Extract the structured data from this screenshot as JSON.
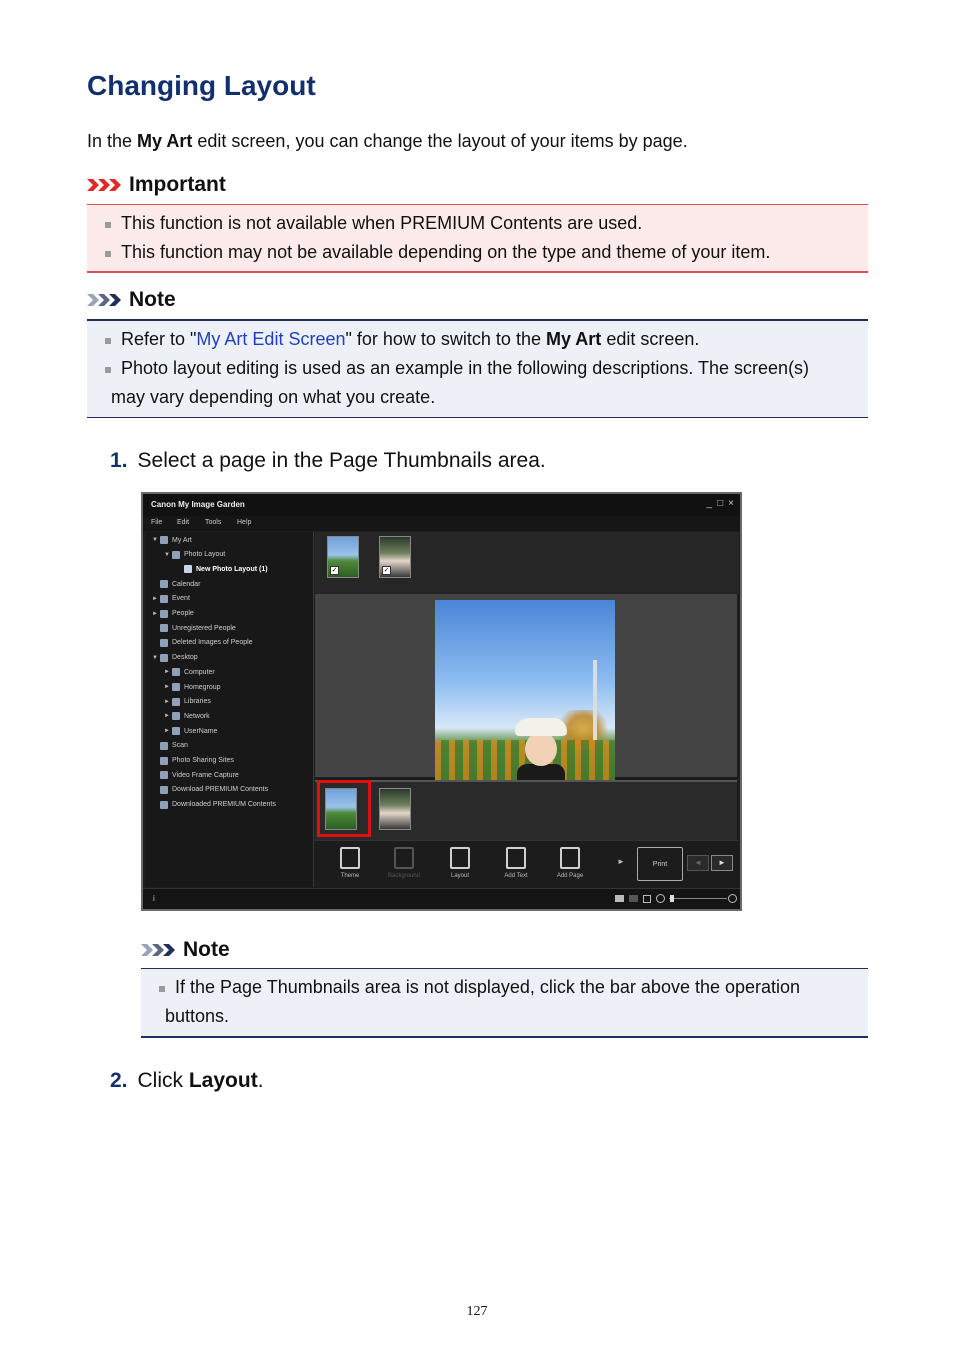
{
  "page": {
    "title": "Changing Layout",
    "intro_before": "In the ",
    "intro_bold": "My Art",
    "intro_after": " edit screen, you can change the layout of your items by page.",
    "page_number": "127"
  },
  "important": {
    "heading": "Important",
    "items": [
      "This function is not available when PREMIUM Contents are used.",
      "This function may not be available depending on the type and theme of your item."
    ]
  },
  "note1": {
    "heading": "Note",
    "item1_before": "Refer to \"",
    "item1_link": "My Art Edit Screen",
    "item1_mid": "\" for how to switch to the ",
    "item1_bold": "My Art",
    "item1_after": " edit screen.",
    "item2_line1": "Photo layout editing is used as an example in the following descriptions. The screen(s)",
    "item2_line2": "may vary depending on what you create."
  },
  "steps": [
    {
      "num": "1.",
      "text": "Select a page in the Page Thumbnails area."
    },
    {
      "num": "2.",
      "text_before": "Click ",
      "text_bold": "Layout",
      "text_after": "."
    }
  ],
  "note2": {
    "heading": "Note",
    "line1": "If the Page Thumbnails area is not displayed, click the bar above the operation",
    "line2": "buttons."
  },
  "app": {
    "window_title": "Canon My Image Garden",
    "window_buttons": [
      "_",
      "□",
      "×"
    ],
    "menu": [
      "File",
      "Edit",
      "Tools",
      "Help"
    ],
    "tree": [
      {
        "label": "My Art",
        "tri": "▼"
      },
      {
        "label": "Photo Layout",
        "tri": "▼"
      },
      {
        "label": "New Photo Layout (1)",
        "tri": ""
      },
      {
        "label": "Calendar",
        "tri": ""
      },
      {
        "label": "Event",
        "tri": "►"
      },
      {
        "label": "People",
        "tri": "►"
      },
      {
        "label": "Unregistered People",
        "tri": ""
      },
      {
        "label": "Deleted Images of People",
        "tri": ""
      },
      {
        "label": "Desktop",
        "tri": "▼"
      },
      {
        "label": "Computer",
        "tri": "►"
      },
      {
        "label": "Homegroup",
        "tri": "►"
      },
      {
        "label": "Libraries",
        "tri": "►"
      },
      {
        "label": "Network",
        "tri": "►"
      },
      {
        "label": "UserName",
        "tri": "►"
      },
      {
        "label": "Scan",
        "tri": ""
      },
      {
        "label": "Photo Sharing Sites",
        "tri": ""
      },
      {
        "label": "Video Frame Capture",
        "tri": ""
      },
      {
        "label": "Download PREMIUM Contents",
        "tri": ""
      },
      {
        "label": "Downloaded PREMIUM Contents",
        "tri": ""
      }
    ],
    "toolbar": {
      "theme": "Theme",
      "background": "Background",
      "layout": "Layout",
      "add_text": "Add Text",
      "add_page": "Add Page",
      "print": "Print"
    },
    "status_info": "i",
    "checkmark": "✓",
    "next": "►",
    "prev": "◄",
    "more": "►"
  },
  "colors": {
    "title": "#13306e",
    "important_border": "#e05050",
    "important_bg": "#fdeaea",
    "note_border": "#1f2f5a",
    "note_bg": "#eef0f7",
    "link": "#1f3fbf",
    "selection": "#e01010"
  }
}
